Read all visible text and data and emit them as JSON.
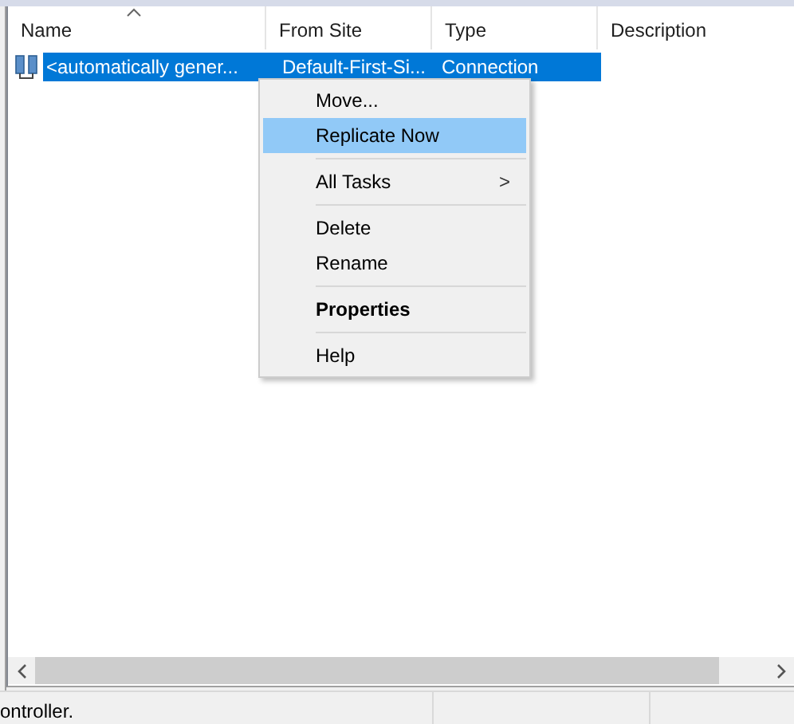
{
  "table": {
    "columns": [
      {
        "label": "Name",
        "sorted": true
      },
      {
        "label": "From Site",
        "sorted": false
      },
      {
        "label": "Type",
        "sorted": false
      },
      {
        "label": "Description",
        "sorted": false
      }
    ],
    "rows": [
      {
        "cells": [
          "<automatically gener...",
          "Default-First-Si...",
          "Connection",
          ""
        ],
        "selected": true
      }
    ]
  },
  "context_menu": [
    {
      "kind": "item",
      "label": "Move...",
      "selected": false,
      "bold": false
    },
    {
      "kind": "item",
      "label": "Replicate Now",
      "selected": true,
      "bold": false
    },
    {
      "kind": "separator"
    },
    {
      "kind": "item",
      "label": "All Tasks",
      "selected": false,
      "bold": false,
      "arrow": ">"
    },
    {
      "kind": "separator"
    },
    {
      "kind": "item",
      "label": "Delete",
      "selected": false,
      "bold": false
    },
    {
      "kind": "item",
      "label": "Rename",
      "selected": false,
      "bold": false
    },
    {
      "kind": "separator"
    },
    {
      "kind": "item",
      "label": "Properties",
      "selected": false,
      "bold": true
    },
    {
      "kind": "separator"
    },
    {
      "kind": "item",
      "label": "Help",
      "selected": false,
      "bold": false
    }
  ],
  "status_bar": [
    "ontroller."
  ]
}
